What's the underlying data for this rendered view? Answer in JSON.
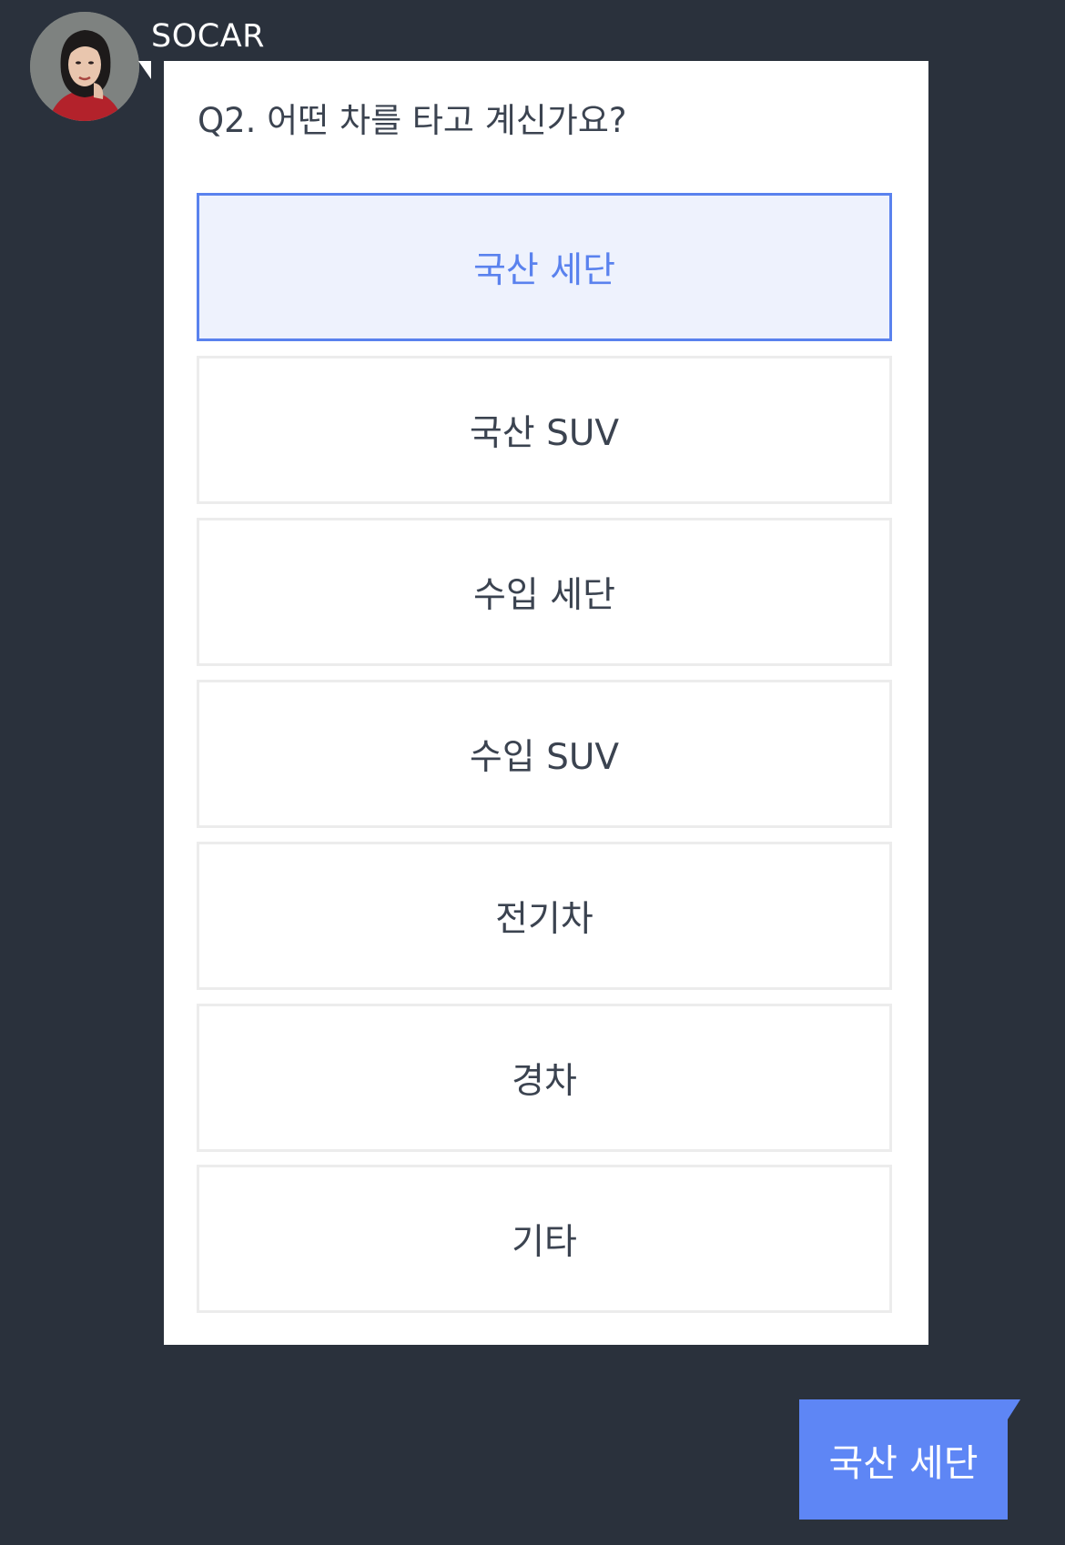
{
  "sender": {
    "name": "SOCAR"
  },
  "question": {
    "title": "Q2. 어떤 차를 타고 계신가요?",
    "options": [
      {
        "label": "국산 세단",
        "selected": true
      },
      {
        "label": "국산 SUV",
        "selected": false
      },
      {
        "label": "수입 세단",
        "selected": false
      },
      {
        "label": "수입 SUV",
        "selected": false
      },
      {
        "label": "전기차",
        "selected": false
      },
      {
        "label": "경차",
        "selected": false
      },
      {
        "label": "기타",
        "selected": false
      }
    ]
  },
  "reply": {
    "text": "국산 세단"
  },
  "colors": {
    "background": "#2a313c",
    "accent": "#5a82ee",
    "reply_bubble": "#5e86f5",
    "selected_bg": "#eef2fd"
  }
}
